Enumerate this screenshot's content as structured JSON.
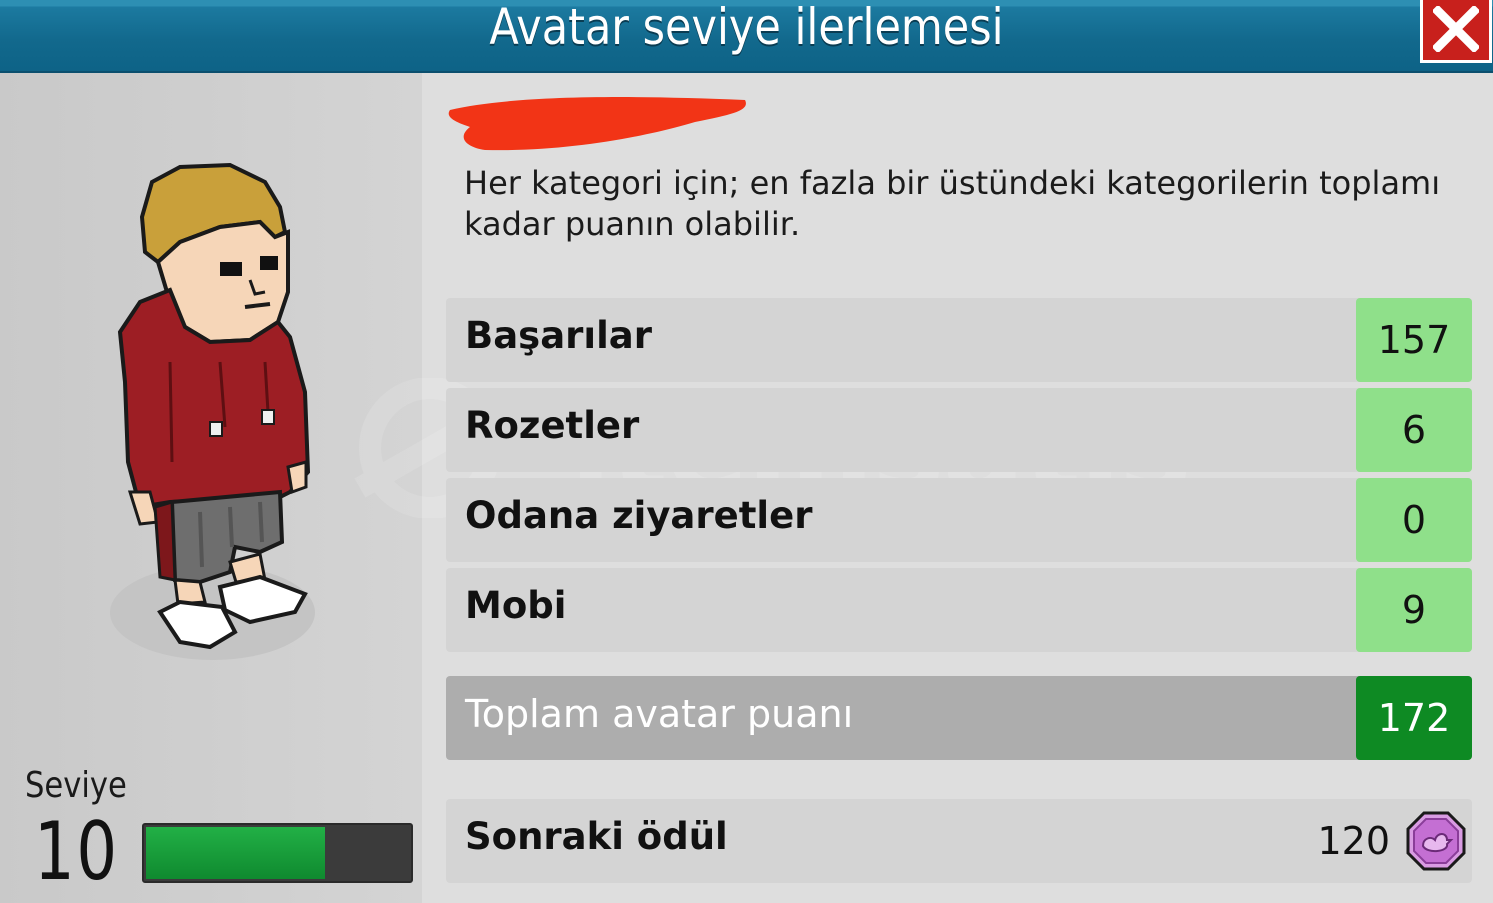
{
  "window": {
    "title": "Avatar seviye ilerlemesi"
  },
  "level": {
    "label": "Seviye",
    "value": "10",
    "progress": 0.68
  },
  "info_text": "Her kategori için; en fazla bir üstündeki kategorilerin toplamı kadar puanın olabilir.",
  "categories": [
    {
      "label": "Başarılar",
      "value": "157"
    },
    {
      "label": "Rozetler",
      "value": "6"
    },
    {
      "label": "Odana ziyaretler",
      "value": "0"
    },
    {
      "label": "Mobi",
      "value": "9"
    }
  ],
  "total": {
    "label": "Toplam avatar puanı",
    "value": "172"
  },
  "next_reward": {
    "label": "Sonraki ödül",
    "value": "120",
    "icon": "duck-badge-icon"
  },
  "watermark": {
    "text": "itemsatış",
    "subtext": "HESAP • SKIN • İTEM • E-PİN",
    "domain": ".com"
  },
  "colors": {
    "title_bar": "#12698d",
    "close": "#c8201c",
    "value_cell": "#8fe08a",
    "total_cell": "#0e8a23",
    "level_fill": "#1ea03e"
  }
}
